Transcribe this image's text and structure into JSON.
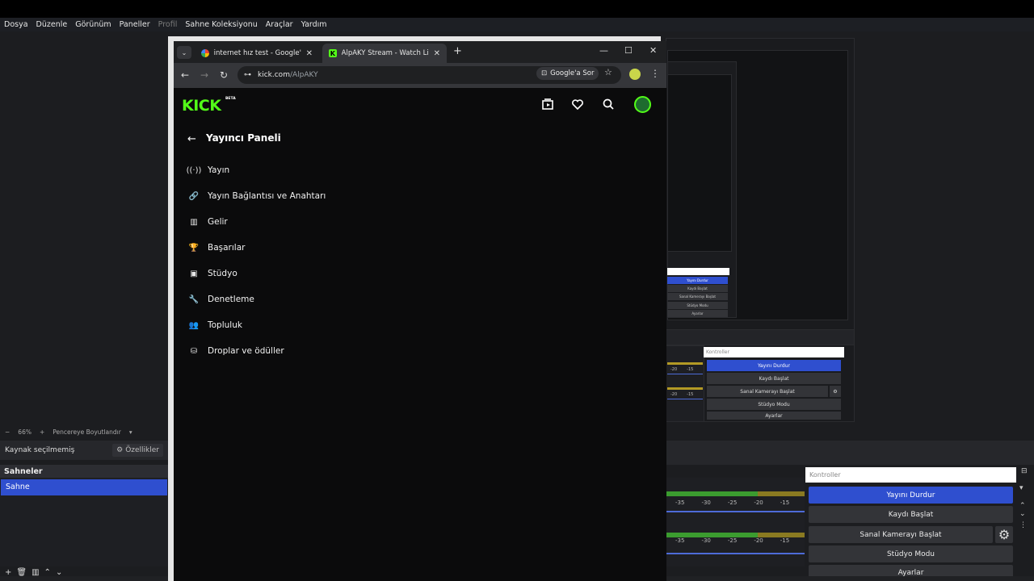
{
  "obs": {
    "menu": [
      "Dosya",
      "Düzenle",
      "Görünüm",
      "Paneller",
      "Profil",
      "Sahne Koleksiyonu",
      "Araçlar",
      "Yardım"
    ],
    "zoom": {
      "minus": "−",
      "value": "66%",
      "plus": "+",
      "fit": "Pencereye Boyutlandır"
    },
    "source_bar": {
      "label": "Kaynak seçilmemiş",
      "properties": "Özellikler"
    },
    "scenes": {
      "header": "Sahneler",
      "items": [
        "Sahne"
      ]
    },
    "meter_ticks_1": [
      "-35",
      "-30",
      "-25",
      "-20",
      "-15"
    ],
    "meter_ticks_2": [
      "-35",
      "-30",
      "-25",
      "-20",
      "-15"
    ],
    "mini_meter_ticks": [
      "-20",
      "-15"
    ],
    "controls": {
      "title": "Kontroller",
      "stop_stream": "Yayını Durdur",
      "start_recording": "Kaydı Başlat",
      "start_virtual_cam": "Sanal Kamerayı Başlat",
      "studio_mode": "Stüdyo Modu",
      "settings": "Ayarlar"
    },
    "accent": "#2f4fcf"
  },
  "browser": {
    "tabs": [
      {
        "title": "internet hız test - Google'da Ar",
        "icon": "google-icon",
        "active": false
      },
      {
        "title": "AlpAKY Stream - Watch Live on",
        "icon": "kick-icon",
        "active": true
      }
    ],
    "url_host": "kick.com",
    "url_path": "/AlpAKY",
    "google_sor": "Google'a Sor"
  },
  "kick": {
    "logo": "KICK",
    "beta": "BETA",
    "brand_color": "#53fc18",
    "panel_title": "Yayıncı Paneli",
    "menu": [
      {
        "label": "Yayın",
        "icon": "broadcast-icon"
      },
      {
        "label": "Yayın Bağlantısı ve Anahtarı",
        "icon": "link-icon"
      },
      {
        "label": "Gelir",
        "icon": "bar-chart-icon"
      },
      {
        "label": "Başarılar",
        "icon": "trophy-icon"
      },
      {
        "label": "Stüdyo",
        "icon": "studio-icon"
      },
      {
        "label": "Denetleme",
        "icon": "wrench-icon"
      },
      {
        "label": "Topluluk",
        "icon": "community-icon"
      },
      {
        "label": "Droplar ve ödüller",
        "icon": "drops-icon"
      }
    ]
  }
}
